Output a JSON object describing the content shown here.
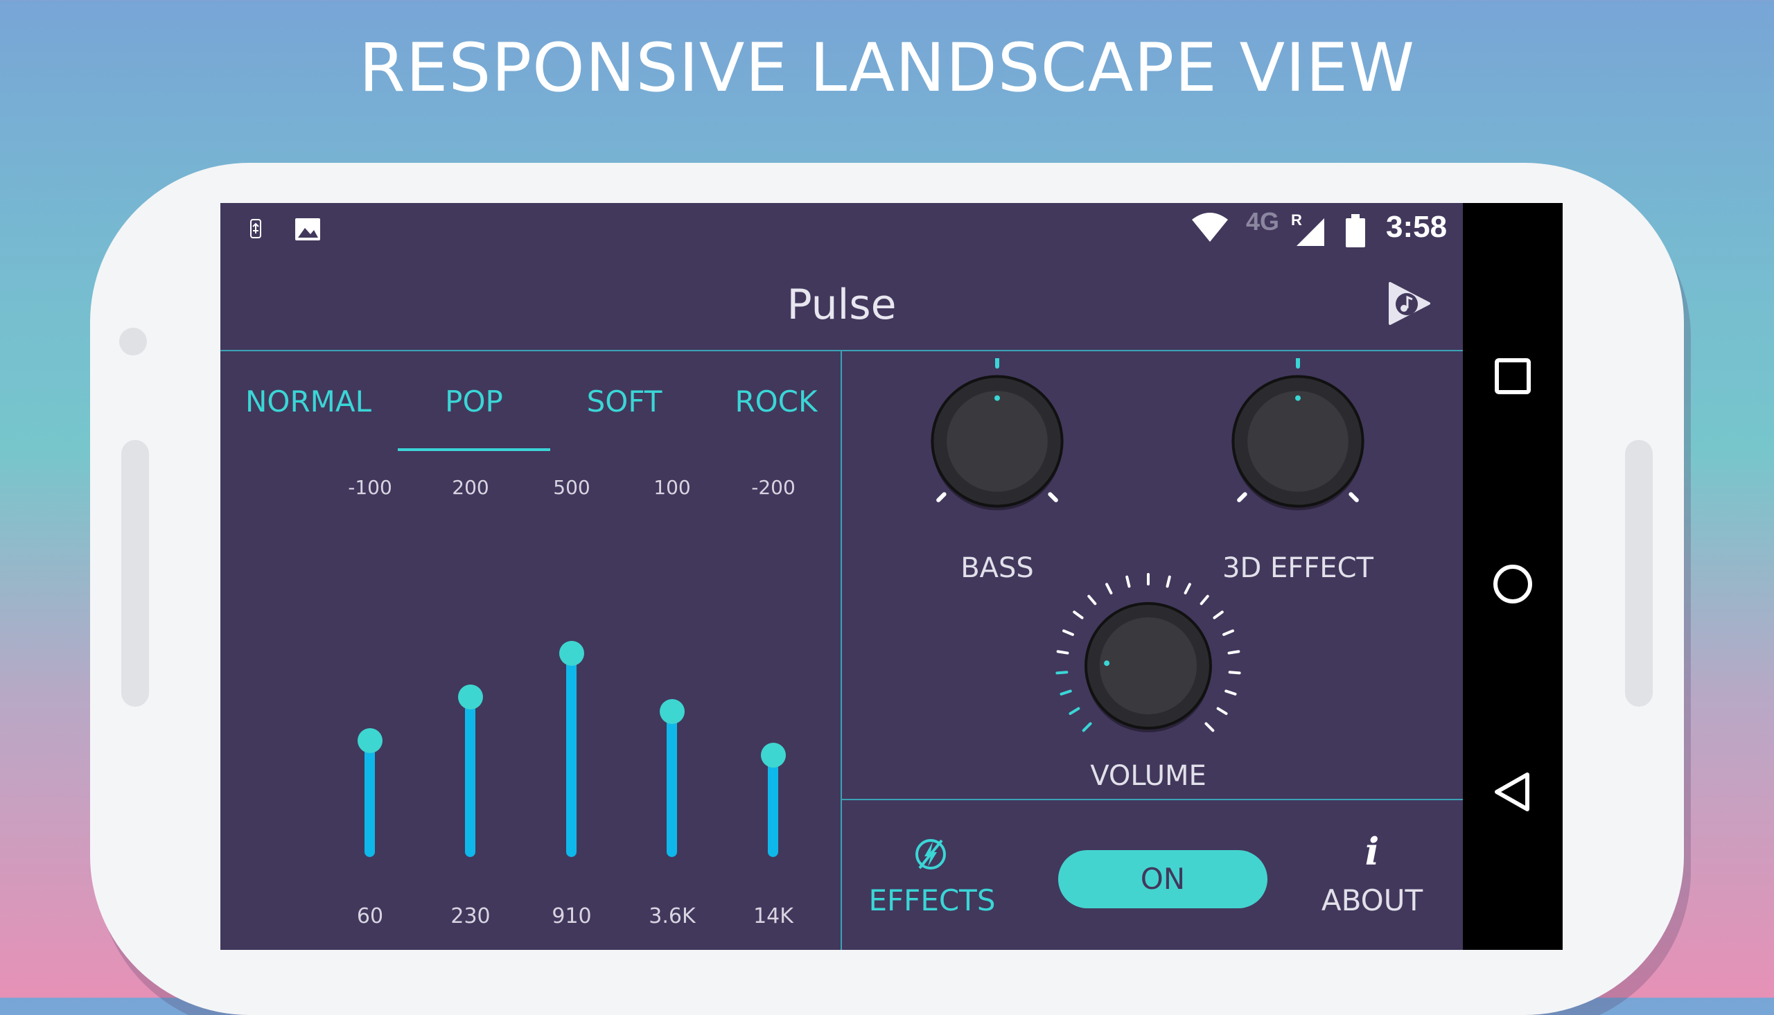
{
  "headline": "RESPONSIVE LANDSCAPE VIEW",
  "status_bar": {
    "network": "4G",
    "roaming": "R",
    "time": "3:58",
    "icons": [
      "usb-debug-icon",
      "image-icon",
      "wifi-icon",
      "signal-icon",
      "battery-icon"
    ]
  },
  "app": {
    "title": "Pulse",
    "logo_icon": "pulse-logo-icon"
  },
  "presets": {
    "tabs": [
      {
        "label": "NORMAL",
        "selected": false
      },
      {
        "label": "POP",
        "selected": true
      },
      {
        "label": "SOFT",
        "selected": false
      },
      {
        "label": "ROCK",
        "selected": false
      }
    ]
  },
  "equalizer": {
    "bands": [
      {
        "gain": "-100",
        "freq": "60",
        "level": 0.24
      },
      {
        "gain": "200",
        "freq": "230",
        "level": 0.33
      },
      {
        "gain": "500",
        "freq": "910",
        "level": 0.42
      },
      {
        "gain": "100",
        "freq": "3.6K",
        "level": 0.3
      },
      {
        "gain": "-200",
        "freq": "14K",
        "level": 0.21
      }
    ]
  },
  "effects": {
    "bass": {
      "label": "BASS",
      "level": 0.5
    },
    "effect3d": {
      "label": "3D EFFECT",
      "level": 0.5
    },
    "volume": {
      "label": "VOLUME",
      "level": 0.18
    }
  },
  "controls": {
    "effects_label": "EFFECTS",
    "effects_icon": "lightning-icon",
    "power_label": "ON",
    "about_label": "ABOUT",
    "about_icon": "i",
    "accent": "#3ad6d6",
    "background": "#42385c"
  },
  "navigation": {
    "buttons": [
      "recents-square-icon",
      "home-circle-icon",
      "back-triangle-icon"
    ]
  }
}
